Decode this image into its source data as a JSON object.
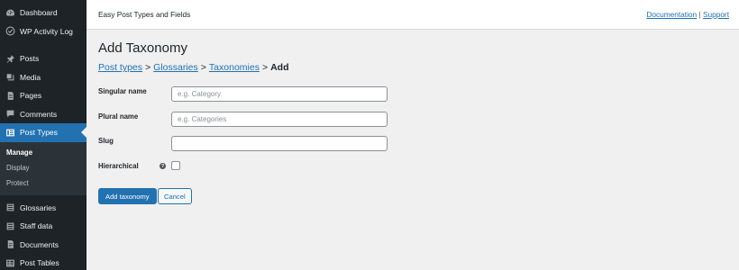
{
  "sidebar": {
    "top_items": [
      {
        "label": "Dashboard",
        "icon": "dashboard-icon"
      },
      {
        "label": "WP Activity Log",
        "icon": "activity-log-icon"
      }
    ],
    "items": [
      {
        "label": "Posts",
        "icon": "pin-icon"
      },
      {
        "label": "Media",
        "icon": "media-icon"
      },
      {
        "label": "Pages",
        "icon": "pages-icon"
      },
      {
        "label": "Comments",
        "icon": "comment-icon"
      },
      {
        "label": "Post Types",
        "icon": "post-types-icon",
        "active": true
      }
    ],
    "submenu": [
      {
        "label": "Manage",
        "current": true
      },
      {
        "label": "Display"
      },
      {
        "label": "Protect"
      }
    ],
    "bottom_items": [
      {
        "label": "Glossaries",
        "icon": "list-icon"
      },
      {
        "label": "Staff data",
        "icon": "list-icon"
      },
      {
        "label": "Documents",
        "icon": "document-icon"
      },
      {
        "label": "Post Tables",
        "icon": "table-icon"
      }
    ]
  },
  "header": {
    "app_title": "Easy Post Types and Fields",
    "documentation_link": "Documentation",
    "link_separator": "|",
    "support_link": "Support"
  },
  "main": {
    "title": "Add Taxonomy",
    "breadcrumb": {
      "post_types": "Post types",
      "glossaries": "Glossaries",
      "taxonomies": "Taxonomies",
      "current": "Add",
      "separator": ">"
    },
    "form": {
      "singular_label": "Singular name",
      "singular_placeholder": "e.g. Category",
      "singular_value": "",
      "plural_label": "Plural name",
      "plural_placeholder": "e.g. Categories",
      "plural_value": "",
      "slug_label": "Slug",
      "slug_value": "",
      "hierarchical_label": "Hierarchical",
      "help_glyph": "?",
      "hierarchical_checked": false
    },
    "buttons": {
      "add_label": "Add taxonomy",
      "cancel_label": "Cancel"
    }
  },
  "colors": {
    "sidebar_bg": "#1d2327",
    "accent": "#2271b1",
    "page_bg": "#f0f0f1"
  }
}
